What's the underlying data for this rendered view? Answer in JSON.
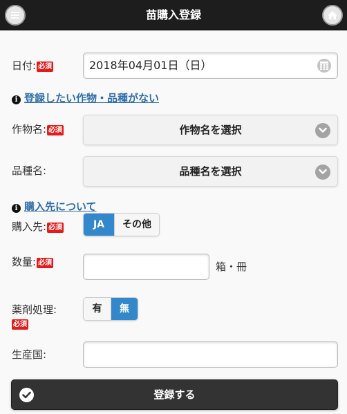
{
  "header": {
    "title": "苗購入登録",
    "menu_icon": "menu-icon",
    "home_icon": "home-icon",
    "background_color": "#1d1d1d"
  },
  "required_badge": "必須",
  "form": {
    "date": {
      "label": "日付:",
      "value": "2018年04月01日（日）",
      "icon": "calendar-icon"
    },
    "crop_link": "登録したい作物・品種がない",
    "crop": {
      "label": "作物名:",
      "select_label": "作物名を選択"
    },
    "variety": {
      "label": "品種名:",
      "select_label": "品種名を選択"
    },
    "supplier_link": "購入先について",
    "supplier": {
      "label": "購入先:",
      "options": [
        "JA",
        "その他"
      ],
      "selected": "JA"
    },
    "quantity": {
      "label": "数量:",
      "value": "",
      "unit": "箱・冊"
    },
    "chemical": {
      "label": "薬剤処理:",
      "options": [
        "有",
        "無"
      ],
      "selected": "無"
    },
    "origin": {
      "label": "生産国:",
      "value": ""
    },
    "submit_label": "登録する"
  },
  "colors": {
    "accent": "#3388cc",
    "required": "#e41b1b",
    "link": "#2f6ea9",
    "submit": "#333333"
  }
}
